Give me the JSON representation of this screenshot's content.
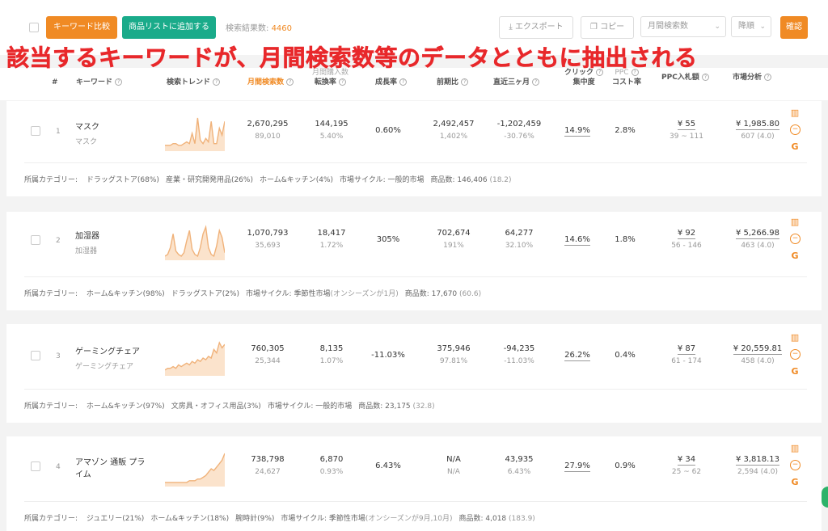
{
  "toolbar": {
    "compare_label": "キーワード比較",
    "add_list_label": "商品リストに追加する",
    "result_label": "検索結果数: ",
    "result_count": "4460",
    "export_label": "エクスポート",
    "copy_label": "コピー",
    "sort_field": "月間検索数",
    "sort_order": "降順",
    "confirm_label": "確認"
  },
  "banner": "該当するキーワードが、月間検索数等のデータとともに抽出される",
  "columns": {
    "index": "#",
    "keyword": "キーワード",
    "trend": "検索トレンド",
    "monthly_search": "月間検索数",
    "conversion_top": "月間購入数",
    "conversion": "転換率",
    "growth": "成長率",
    "mom": "前期比",
    "recent3": "直近三ヶ月",
    "click_top": "クリック",
    "click": "集中度",
    "ppc_top": "PPC",
    "ppc_cost": "コスト率",
    "ppc_bid": "PPC入札額",
    "market": "市場分析"
  },
  "rows": [
    {
      "index": "1",
      "keyword": "マスク",
      "keyword_sub": "マスク",
      "search": "2,670,295",
      "search_sub": "89,010",
      "conv": "144,195",
      "conv_sub": "5.40%",
      "growth": "0.60%",
      "mom": "2,492,457",
      "mom_sub": "1,402%",
      "recent": "-1,202,459",
      "recent_sub": "-30.76%",
      "click": "14.9%",
      "cost": "2.8%",
      "bid": "¥ 55",
      "bid_sub": "39 ~ 111",
      "market": "¥ 1,985.80",
      "market_sub": "607 (4.0)",
      "categories": [
        "所属カテゴリー: ",
        "ドラッグストア(68%)",
        "産業・研究開発用品(26%)",
        "ホーム&キッチン(4%)",
        "市場サイクル: 一般的市場",
        "商品数: 146,406 ",
        "(18.2)"
      ],
      "trend": [
        2,
        2,
        2,
        3,
        3,
        2,
        2,
        3,
        4,
        3,
        9,
        3,
        18,
        5,
        3,
        6,
        4,
        16,
        3,
        3,
        12,
        8,
        16
      ]
    },
    {
      "index": "2",
      "keyword": "加湿器",
      "keyword_sub": "加湿器",
      "search": "1,070,793",
      "search_sub": "35,693",
      "conv": "18,417",
      "conv_sub": "1.72%",
      "growth": "305%",
      "mom": "702,674",
      "mom_sub": "191%",
      "recent": "64,277",
      "recent_sub": "32.10%",
      "click": "14.6%",
      "cost": "1.8%",
      "bid": "¥ 92",
      "bid_sub": "56 - 146",
      "market": "¥ 5,266.98",
      "market_sub": "463 (4.0)",
      "categories": [
        "所属カテゴリー: ",
        "ホーム&キッチン(98%)",
        "ドラッグストア(2%)",
        "市場サイクル: 季節性市場",
        "(オンシーズンが1月)",
        "商品数: 17,670 ",
        "(60.6)"
      ],
      "trend": [
        1,
        2,
        6,
        14,
        4,
        2,
        1,
        3,
        10,
        16,
        5,
        2,
        1,
        6,
        14,
        18,
        6,
        2,
        1,
        7,
        16,
        12,
        3
      ]
    },
    {
      "index": "3",
      "keyword": "ゲーミングチェア",
      "keyword_sub": "ゲーミングチェア",
      "search": "760,305",
      "search_sub": "25,344",
      "conv": "8,135",
      "conv_sub": "1.07%",
      "growth": "-11.03%",
      "mom": "375,946",
      "mom_sub": "97.81%",
      "recent": "-94,235",
      "recent_sub": "-11.03%",
      "click": "26.2%",
      "cost": "0.4%",
      "bid": "¥ 87",
      "bid_sub": "61 - 174",
      "market": "¥ 20,559.81",
      "market_sub": "458 (4.0)",
      "categories": [
        "所属カテゴリー: ",
        "ホーム&キッチン(97%)",
        "文房具・オフィス用品(3%)",
        "市場サイクル: 一般的市場",
        "商品数: 23,175 ",
        "(32.8)"
      ],
      "trend": [
        2,
        3,
        3,
        4,
        3,
        5,
        4,
        5,
        6,
        5,
        7,
        6,
        8,
        7,
        9,
        8,
        10,
        9,
        14,
        12,
        18,
        15,
        17
      ]
    },
    {
      "index": "4",
      "keyword": "アマゾン 通販 プライム",
      "keyword_sub": "",
      "search": "738,798",
      "search_sub": "24,627",
      "conv": "6,870",
      "conv_sub": "0.93%",
      "growth": "6.43%",
      "mom": "N/A",
      "mom_sub": "N/A",
      "recent": "43,935",
      "recent_sub": "6.43%",
      "click": "27.9%",
      "cost": "0.9%",
      "bid": "¥ 34",
      "bid_sub": "25 ~ 62",
      "market": "¥ 3,818.13",
      "market_sub": "2,594 (4.0)",
      "categories": [
        "所属カテゴリー: ",
        "ジュエリー(21%)",
        "ホーム&キッチン(18%)",
        "腕時計(9%)",
        "市場サイクル: 季節性市場",
        "(オンシーズンが9月,10月)",
        "商品数: 4,018 ",
        "(183.9)"
      ],
      "trend": [
        1,
        1,
        1,
        1,
        1,
        1,
        1,
        1,
        1,
        2,
        2,
        2,
        3,
        3,
        4,
        5,
        7,
        9,
        8,
        10,
        12,
        14,
        18
      ]
    }
  ],
  "colors": {
    "accent": "#f08a24",
    "green": "#1aab8a",
    "banner": "#e8282b"
  }
}
